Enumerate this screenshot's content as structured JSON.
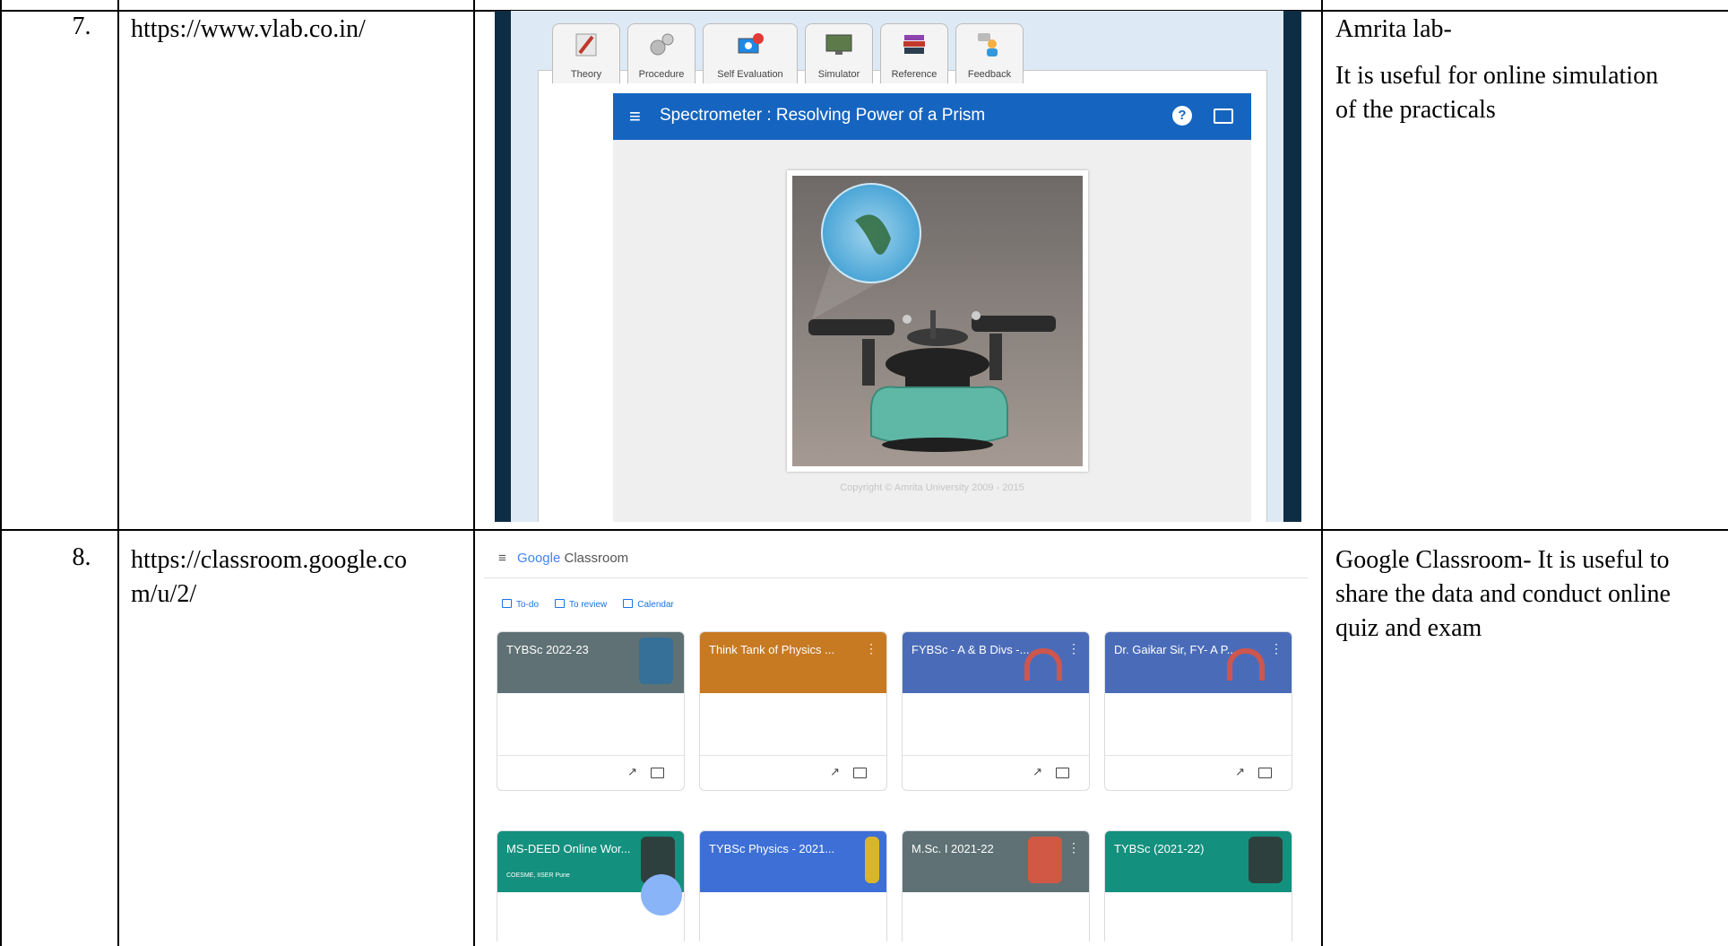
{
  "rows": [
    {
      "number": "7.",
      "url": "https://www.vlab.co.in/",
      "description_lines": [
        "Amrita lab-",
        "It is useful for online simulation",
        "of the practicals"
      ]
    },
    {
      "number": "8.",
      "url_lines": [
        "https://classroom.google.co",
        "m/u/2/"
      ],
      "description_lines": [
        "Google Classroom- It is useful to",
        "share the data and conduct online",
        "quiz and  exam"
      ]
    }
  ],
  "vlab": {
    "tabs": [
      {
        "label": "Theory",
        "icon": "pencil-icon"
      },
      {
        "label": "Procedure",
        "icon": "gears-icon"
      },
      {
        "label": "Self Evaluation",
        "icon": "globe-monitor-icon"
      },
      {
        "label": "Simulator",
        "icon": "monitor-icon"
      },
      {
        "label": "Reference",
        "icon": "books-icon"
      },
      {
        "label": "Feedback",
        "icon": "person-chat-icon"
      }
    ],
    "header_title": "Spectrometer : Resolving Power of a Prism",
    "help_glyph": "?",
    "copyright": "Copyright © Amrita University 2009 - 2015"
  },
  "classroom": {
    "brand_google": "Google",
    "brand_product": "Classroom",
    "nav": [
      "To-do",
      "To review",
      "Calendar"
    ],
    "cards": [
      {
        "title": "TYBSc 2022-23",
        "subtitle": "",
        "color": "#5f7175"
      },
      {
        "title": "Think Tank of Physics ...",
        "subtitle": "",
        "color": "#c77a22"
      },
      {
        "title": "FYBSc - A & B Divs -...",
        "subtitle": "",
        "color": "#4a6cb8"
      },
      {
        "title": "Dr. Gaikar Sir, FY- A P...",
        "subtitle": "",
        "color": "#4a6cb8"
      },
      {
        "title": "MS-DEED Online Wor...",
        "subtitle": "COESME, IISER Pune",
        "color": "#14907e"
      },
      {
        "title": "TYBSc Physics - 2021...",
        "subtitle": "",
        "color": "#3d6fd6"
      },
      {
        "title": "M.Sc. I 2021-22",
        "subtitle": "",
        "color": "#5f7175"
      },
      {
        "title": "TYBSc (2021-22)",
        "subtitle": "",
        "color": "#14907e"
      }
    ]
  }
}
